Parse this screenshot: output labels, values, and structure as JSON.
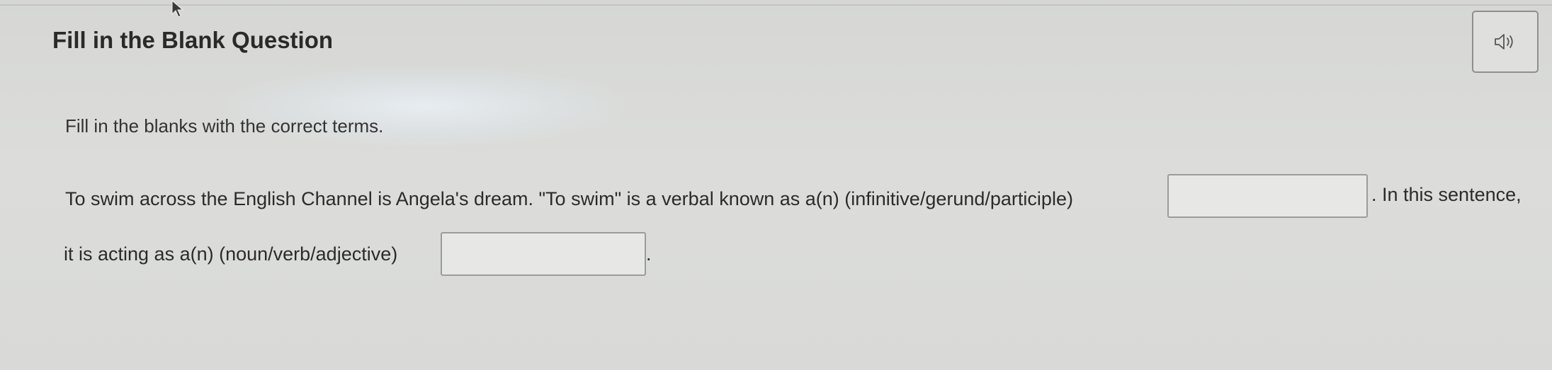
{
  "question": {
    "title": "Fill in the Blank Question",
    "audio_icon": "speaker-icon"
  },
  "instructions": "Fill in the blanks with the correct terms.",
  "sentence": {
    "part1": "To swim across the English Channel is Angela's dream. \"To swim\" is a verbal known as a(n) (infinitive/gerund/participle)",
    "part2": ". In this sentence,",
    "part3": "it is acting as a(n) (noun/verb/adjective)",
    "part4": "."
  },
  "blanks": [
    {
      "value": "",
      "placeholder": ""
    },
    {
      "value": "",
      "placeholder": ""
    }
  ]
}
